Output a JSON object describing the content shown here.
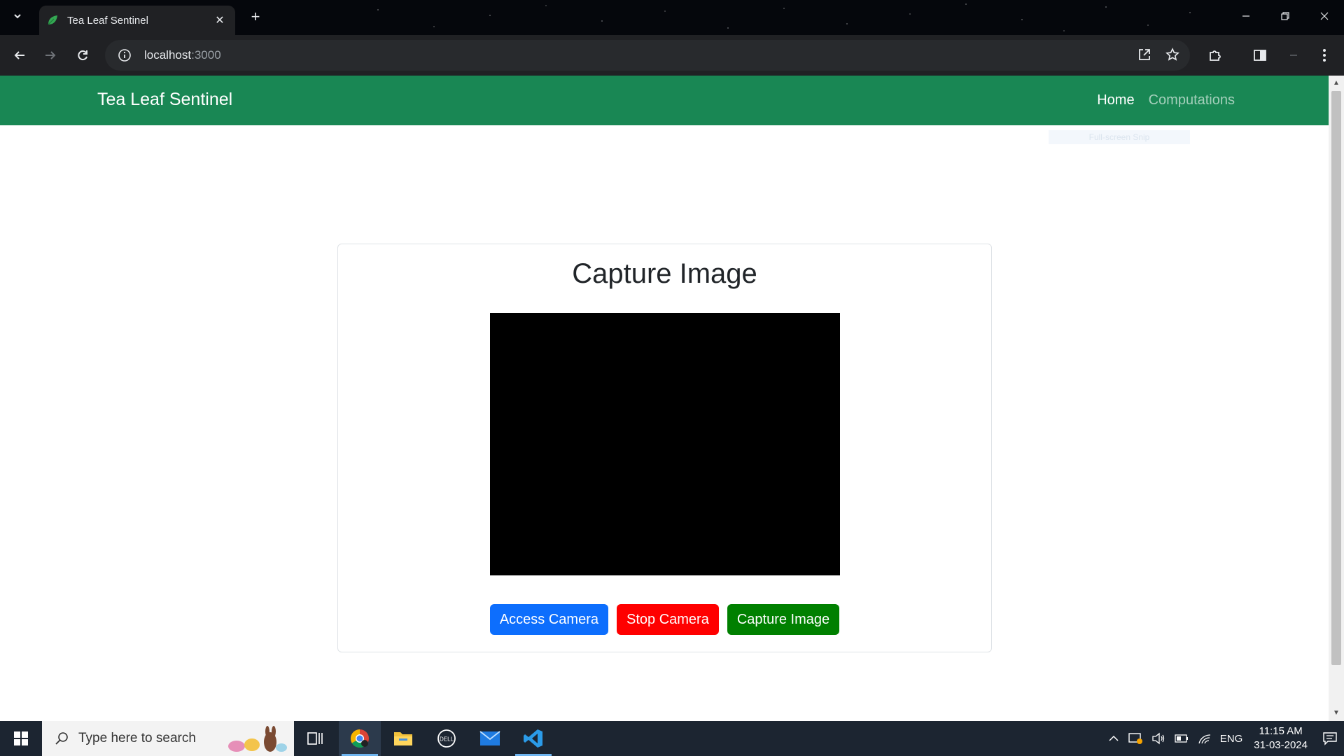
{
  "browser": {
    "tab_title": "Tea Leaf Sentinel",
    "url_host": "localhost",
    "url_port": ":3000",
    "new_tab_symbol": "+",
    "close_symbol": "✕"
  },
  "navbar": {
    "brand": "Tea Leaf Sentinel",
    "links": [
      {
        "label": "Home",
        "active": true
      },
      {
        "label": "Computations",
        "active": false
      }
    ],
    "color": "#198754"
  },
  "overlay": {
    "snip_hint": "Full-screen Snip"
  },
  "card": {
    "title": "Capture Image",
    "buttons": [
      {
        "label": "Access Camera",
        "color": "#0d6efd"
      },
      {
        "label": "Stop Camera",
        "color": "#ff0000"
      },
      {
        "label": "Capture Image",
        "color": "#008000"
      }
    ]
  },
  "taskbar": {
    "search_placeholder": "Type here to search",
    "language": "ENG",
    "time": "11:15 AM",
    "date": "31-03-2024",
    "apps": [
      "task-view-icon",
      "chrome-icon",
      "file-explorer-icon",
      "dell-icon",
      "mail-icon",
      "vscode-icon"
    ]
  }
}
